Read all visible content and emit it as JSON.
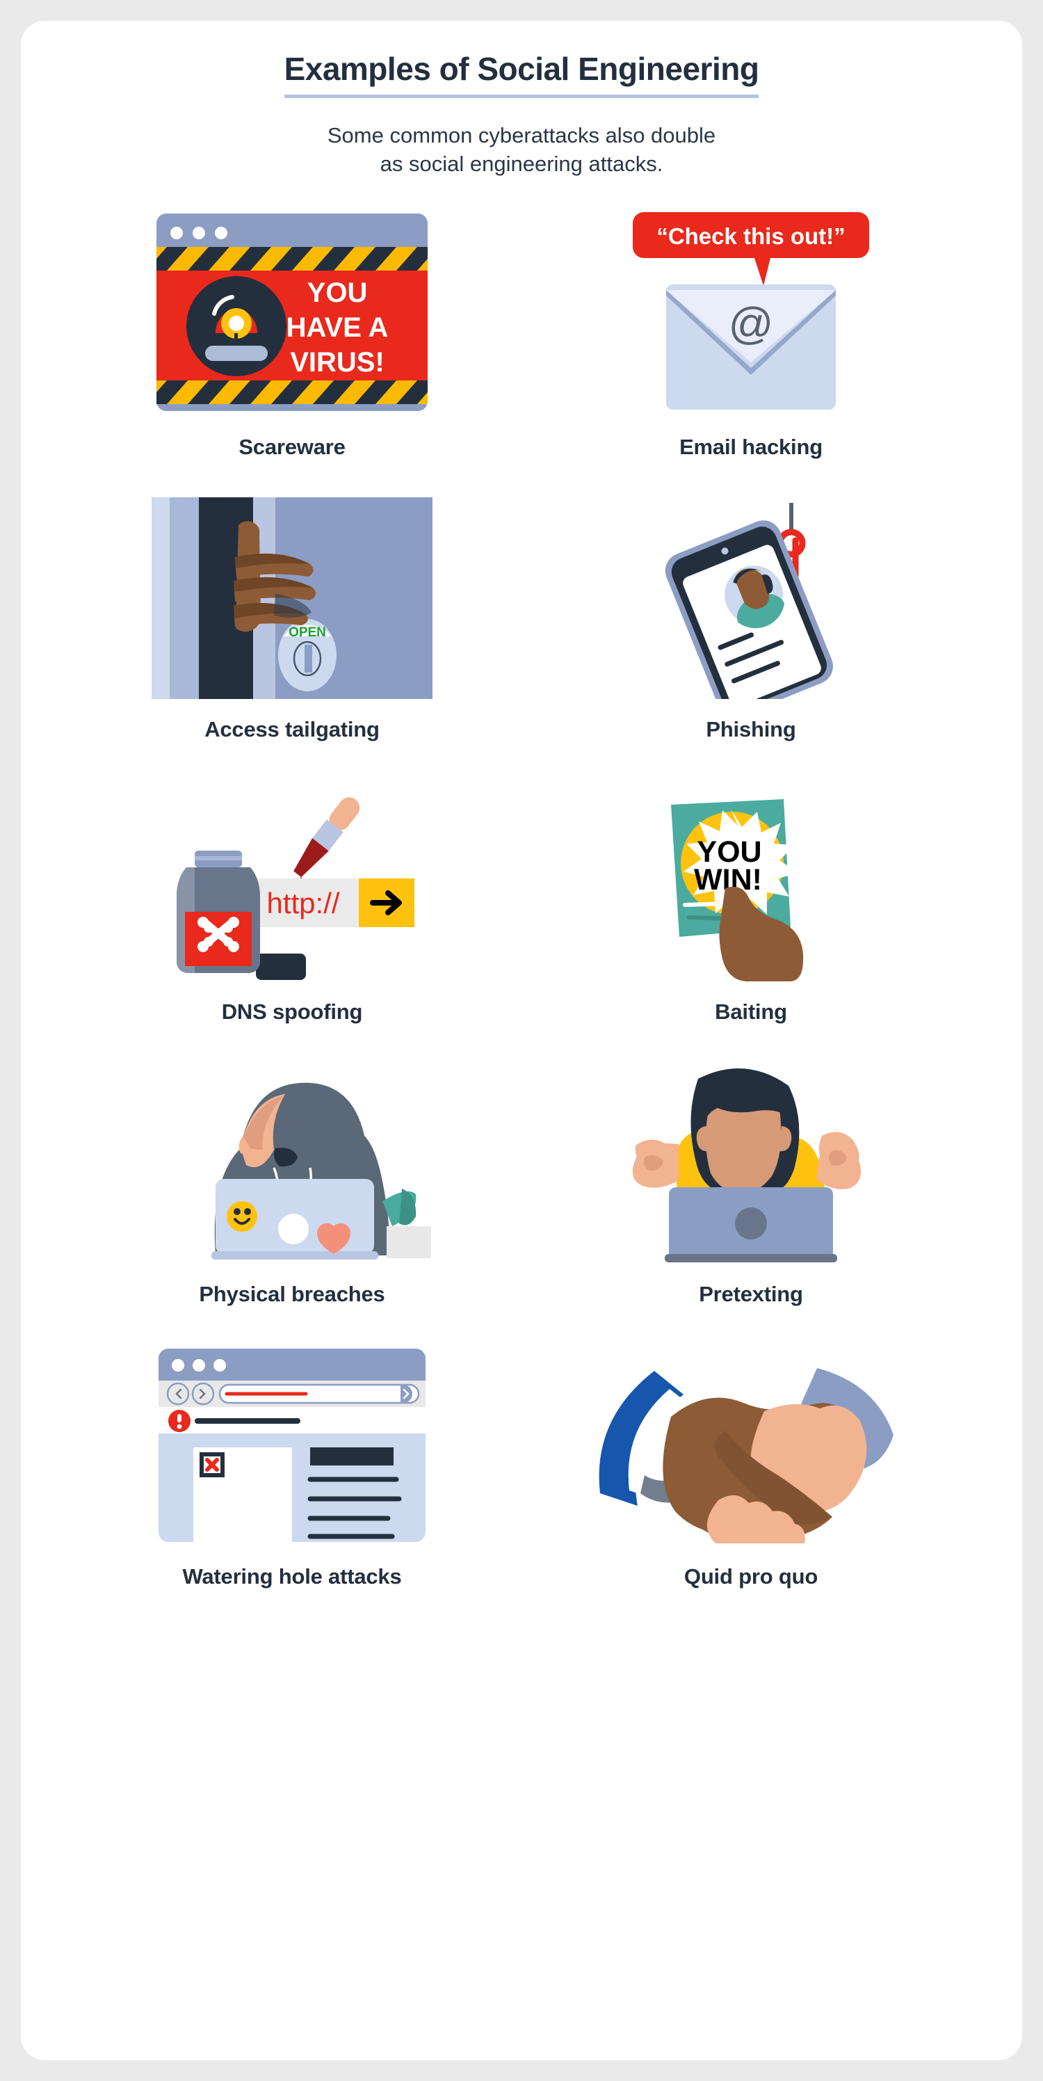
{
  "header": {
    "title": "Examples of Social Engineering",
    "subtitle_line1": "Some common cyberattacks also double",
    "subtitle_line2": "as social engineering attacks."
  },
  "colors": {
    "page_background": "#eaeaea",
    "card_background": "#ffffff",
    "ink": "#242f3e",
    "title_underline": "#b4c3de",
    "alert_red": "#e8291c",
    "hazard_yellow": "#fbba00",
    "accent_yellow": "#ffc20e",
    "teal": "#4aab9e",
    "slate_blue": "#8c9dc4",
    "light_blue": "#ccd9ef",
    "skin_dark": "#8d5b35",
    "skin_light": "#f2b391",
    "hoodie_slate": "#5b6877",
    "sleeve_blue": "#1657ad"
  },
  "items": [
    {
      "id": "scareware",
      "label": "Scareware",
      "icon": "scareware-browser-alert-icon",
      "art_text": {
        "line1": "YOU",
        "line2": "HAVE A",
        "line3": "VIRUS!"
      }
    },
    {
      "id": "email-hacking",
      "label": "Email hacking",
      "icon": "envelope-speech-bubble-icon",
      "art_text": {
        "bubble": "“Check this out!”",
        "envelope_symbol": "@"
      }
    },
    {
      "id": "access-tailgating",
      "label": "Access tailgating",
      "icon": "door-hand-open-icon",
      "art_text": {
        "lock_status": "OPEN"
      }
    },
    {
      "id": "phishing",
      "label": "Phishing",
      "icon": "phone-fish-hook-icon",
      "art_text": {}
    },
    {
      "id": "dns-spoofing",
      "label": "DNS spoofing",
      "icon": "poison-bottle-url-bar-icon",
      "art_text": {
        "url": "http://",
        "go_button": "→"
      }
    },
    {
      "id": "baiting",
      "label": "Baiting",
      "icon": "hand-holding-flyer-icon",
      "art_text": {
        "line1": "YOU",
        "line2": "WIN!"
      }
    },
    {
      "id": "physical-breaches",
      "label": "Physical breaches",
      "icon": "hooded-figure-laptop-icon",
      "art_text": {}
    },
    {
      "id": "pretexting",
      "label": "Pretexting",
      "icon": "person-laptop-cheering-icon",
      "art_text": {}
    },
    {
      "id": "watering-hole-attacks",
      "label": "Watering hole attacks",
      "icon": "browser-warning-broken-page-icon",
      "art_text": {}
    },
    {
      "id": "quid-pro-quo",
      "label": "Quid pro quo",
      "icon": "handshake-icon",
      "art_text": {}
    }
  ]
}
